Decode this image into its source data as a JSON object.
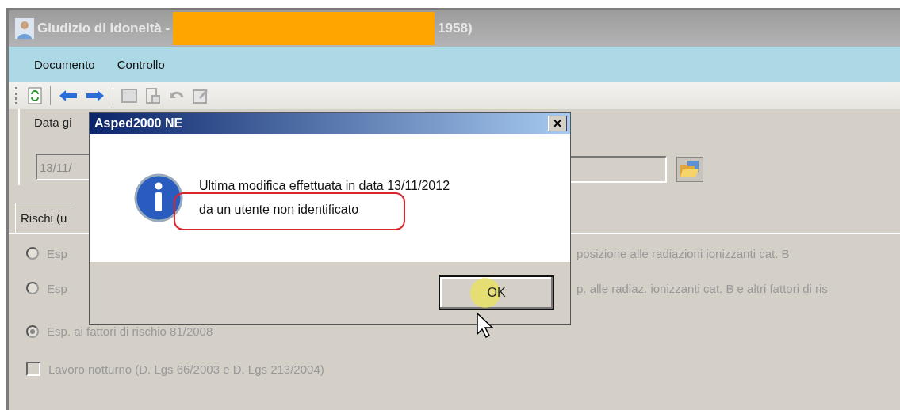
{
  "window": {
    "title_start": "Giudizio di idoneità -",
    "title_end": "1958)"
  },
  "menu": [
    "Documento",
    "Controllo"
  ],
  "toolbar": [
    {
      "kind": "refresh",
      "disabled": false
    },
    {
      "kind": "separator"
    },
    {
      "kind": "back",
      "disabled": false
    },
    {
      "kind": "forward",
      "disabled": false
    },
    {
      "kind": "separator"
    },
    {
      "kind": "save",
      "disabled": true
    },
    {
      "kind": "paste",
      "disabled": true
    },
    {
      "kind": "undo",
      "disabled": true
    },
    {
      "kind": "edit",
      "disabled": true
    }
  ],
  "date_group": {
    "label": "Data gi",
    "value": "13/11/"
  },
  "tab": {
    "label": "Rischi (u",
    "selected": true
  },
  "radios": [
    {
      "label": "Esp",
      "label_end": "posizione alle radiazioni ionizzanti cat. B",
      "selected": false
    },
    {
      "label": "Esp",
      "label_end": "p. alle radiaz. ionizzanti cat. B e altri fattori di ris",
      "selected": false
    },
    {
      "label": "Esp. ai fattori di rischio 81/2008",
      "selected": true
    }
  ],
  "checkboxes": [
    {
      "label": "Lavoro notturno (D. Lgs 66/2003 e D. Lgs 213/2004)",
      "checked": false
    }
  ],
  "dialog": {
    "title": "Asped2000 NE",
    "close": "×",
    "message": [
      "Ultima modifica effettuata in data 13/11/2012",
      "da un utente non identificato"
    ],
    "button": "OK"
  }
}
